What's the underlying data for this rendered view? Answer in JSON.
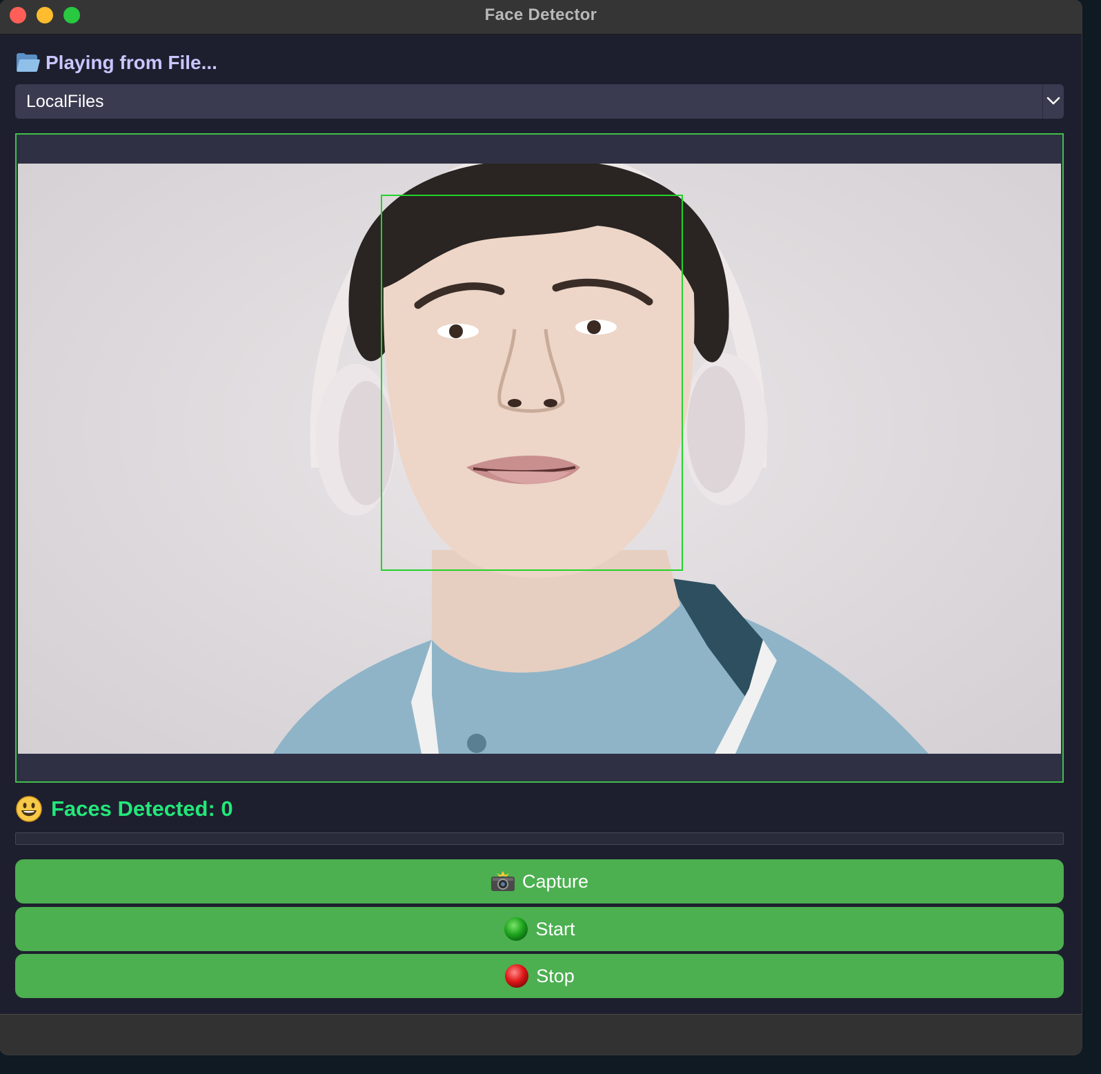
{
  "window": {
    "title": "Face Detector"
  },
  "status": {
    "icon": "folder-icon",
    "text": "Playing from File..."
  },
  "source_select": {
    "selected": "LocalFiles",
    "icon": "chevron-down-icon"
  },
  "video": {
    "detection_box_color": "#22d32a",
    "frame_border_color": "#3fbf4a"
  },
  "detection": {
    "icon": "smiley-icon",
    "text": "Faces Detected: 0"
  },
  "progress": {
    "fraction": 0
  },
  "buttons": {
    "capture": {
      "label": "Capture",
      "icon": "camera-flash-icon"
    },
    "start": {
      "label": "Start",
      "icon": "green-circle-icon"
    },
    "stop": {
      "label": "Stop",
      "icon": "red-circle-icon"
    }
  },
  "colors": {
    "accent": "#4caf50",
    "background": "#1e1f2e",
    "status_text": "#c9c6ff",
    "detection_text": "#22e87a"
  }
}
